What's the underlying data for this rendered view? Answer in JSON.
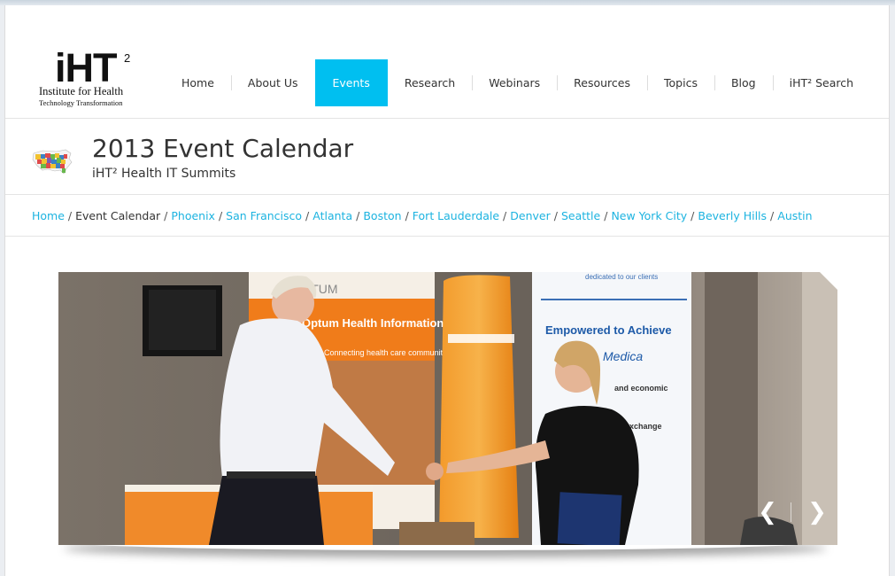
{
  "logo": {
    "main": "iHT",
    "sup": "2",
    "line1": "Institute for Health",
    "line2": "Technology Transformation"
  },
  "nav": {
    "items": [
      {
        "label": "Home"
      },
      {
        "label": "About Us"
      },
      {
        "label": "Events"
      },
      {
        "label": "Research"
      },
      {
        "label": "Webinars"
      },
      {
        "label": "Resources"
      },
      {
        "label": "Topics"
      },
      {
        "label": "Blog"
      },
      {
        "label": "iHT² Search"
      }
    ],
    "active": "Events",
    "active_color": "#00bff0"
  },
  "title": {
    "heading": "2013 Event Calendar",
    "subtitle": "iHT² Health IT Summits",
    "icon": "us-map-icon"
  },
  "breadcrumb": {
    "home": "Home",
    "current": "Event Calendar",
    "cities": [
      "Phoenix",
      "San Francisco",
      "Atlanta",
      "Boston",
      "Fort Lauderdale",
      "Denver",
      "Seattle",
      "New York City",
      "Beverly Hills",
      "Austin"
    ],
    "separator": "/",
    "link_color": "#1cb3e0"
  },
  "slider": {
    "banner_text_1": "OPTUM",
    "banner_text_2": "Optum Health Information Ex",
    "banner_text_3": "Connecting health care communit",
    "banner_text_4": "dedicated to our clients",
    "banner_text_5": "Empowered to Achieve",
    "banner_text_6": "Medica",
    "banner_text_7": "and economic",
    "banner_text_8": "exchange",
    "prev_icon": "chevron-left-icon",
    "next_icon": "chevron-right-icon",
    "prev_glyph": "❮",
    "next_glyph": "❯"
  }
}
